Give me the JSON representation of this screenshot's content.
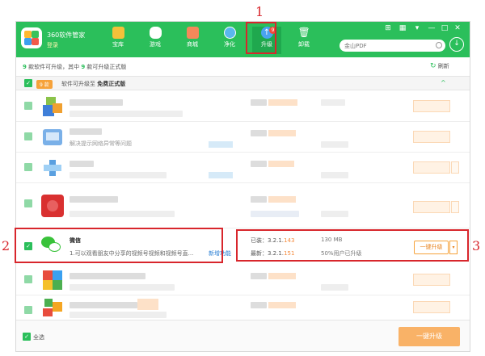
{
  "header": {
    "brand": "360软件管家",
    "login": "登录",
    "nav": [
      {
        "label": "宝库",
        "icon": "treasure-icon",
        "color": "#f4c13a"
      },
      {
        "label": "游戏",
        "icon": "gamepad-icon",
        "color": "#ffffff"
      },
      {
        "label": "商城",
        "icon": "shop-bag-icon",
        "color": "#f5885a"
      },
      {
        "label": "净化",
        "icon": "purify-icon",
        "color": "#5ab7ef"
      },
      {
        "label": "升级",
        "icon": "upgrade-arrow-icon",
        "color": "#4aa3f0",
        "badge": "9",
        "active": true
      },
      {
        "label": "卸载",
        "icon": "trash-icon",
        "color": "#ffffff"
      }
    ],
    "window_controls": [
      "⊞",
      "▦",
      "▾",
      "—",
      "□",
      "✕"
    ],
    "search_placeholder": "金山PDF",
    "download_icon": "↓"
  },
  "summary": {
    "count1": "9",
    "text1": " 款软件可升级，其中 ",
    "count2": "9",
    "text2": " 款可升级正式版",
    "refresh": "刷新"
  },
  "group": {
    "tag": "9 款",
    "text_prefix": "软件可升级至",
    "text_bold": "免费正式版",
    "collapse": "^"
  },
  "rows": [
    {
      "desc": "",
      "icon_colors": [
        "#8bc34a",
        "#3f7fd9",
        "#f0a030"
      ]
    },
    {
      "desc": "解决提示网络异常等问题",
      "icon_colors": [
        "#4a90d9",
        "#9cc6f0",
        "#7ab0e8"
      ]
    },
    {
      "desc": "",
      "icon_colors": [
        "#5aa0e0",
        "#9fd0f5",
        "#3a7fc8"
      ]
    },
    {
      "desc": "",
      "icon_colors": [
        "#d93030",
        "#e86060",
        "#b82020"
      ]
    }
  ],
  "wechat": {
    "name": "微信",
    "desc": "1.可以观看朋友中分享的视频号视频和视频号直...",
    "new_func": "新增功能",
    "installed_label": "已装：",
    "installed_ver": "3.2.1.",
    "installed_ver_hl": "143",
    "size": "130 MB",
    "latest_label": "最新：",
    "latest_ver": "3.2.1.",
    "latest_ver_hl": "151",
    "stat": "50%用户已升级",
    "btn": "一键升级",
    "dd": "▾"
  },
  "rows2": [
    {
      "icon_colors": [
        "#e84c3d",
        "#3aa0f0",
        "#f5c02a",
        "#4caf50"
      ]
    },
    {
      "icon_colors": [
        "#4caf50",
        "#f5a623",
        "#e84c3d",
        "#3a86d9"
      ]
    }
  ],
  "footer": {
    "select_all": "全选",
    "big_btn": "一键升级"
  },
  "annotations": [
    "1",
    "2",
    "3"
  ]
}
